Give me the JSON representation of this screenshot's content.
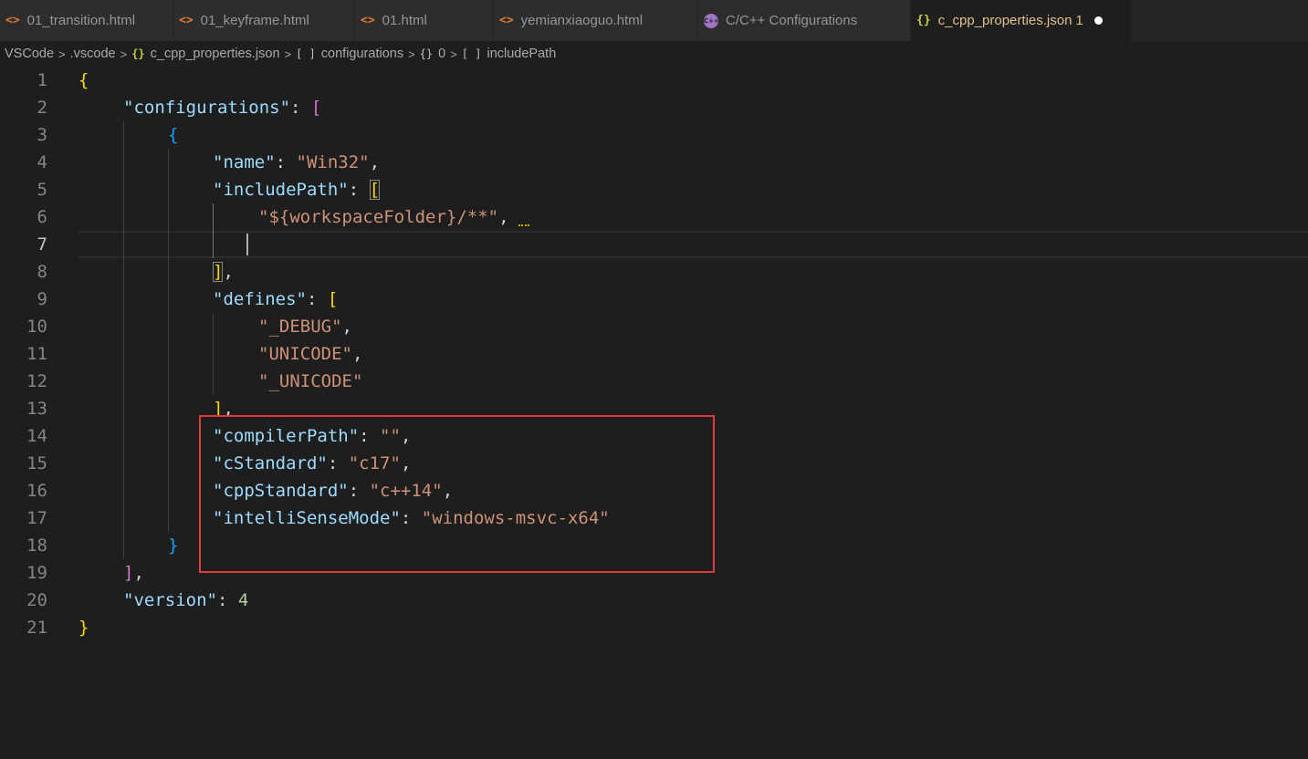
{
  "tabs": [
    {
      "label": "01_transition.html",
      "icon": "html-file-icon",
      "active": false
    },
    {
      "label": "01_keyframe.html",
      "icon": "html-file-icon",
      "active": false
    },
    {
      "label": "01.html",
      "icon": "html-file-icon",
      "active": false
    },
    {
      "label": "yemianxiaoguo.html",
      "icon": "html-file-icon",
      "active": false
    },
    {
      "label": "C/C++ Configurations",
      "icon": "cpp-extension-icon",
      "active": false
    },
    {
      "label": "c_cpp_properties.json",
      "icon": "json-file-icon",
      "active": true,
      "problem_count": "1",
      "dirty": true
    }
  ],
  "tab_icons": {
    "html": "<>",
    "json": "{}",
    "cpp": "C++"
  },
  "breadcrumb": {
    "items": [
      {
        "label": "VSCode"
      },
      {
        "label": ".vscode"
      },
      {
        "icon": "{}",
        "label": "c_cpp_properties.json"
      },
      {
        "icon": "[ ]",
        "label": "configurations"
      },
      {
        "icon": "{}",
        "label": "0"
      },
      {
        "icon": "[ ]",
        "label": "includePath"
      }
    ],
    "separator": ">"
  },
  "editor": {
    "current_line": 7,
    "line_numbers": [
      "1",
      "2",
      "3",
      "4",
      "5",
      "6",
      "7",
      "8",
      "9",
      "10",
      "11",
      "12",
      "13",
      "14",
      "15",
      "16",
      "17",
      "18",
      "19",
      "20",
      "21"
    ],
    "code": {
      "l1_open": "{",
      "l2_key": "\"configurations\"",
      "l2_colon": ": ",
      "l2_open": "[",
      "l3_open": "{",
      "l4_key": "\"name\"",
      "l4_colon": ": ",
      "l4_val": "\"Win32\"",
      "l4_comma": ",",
      "l5_key": "\"includePath\"",
      "l5_colon": ": ",
      "l5_open": "[",
      "l6_val": "\"${workspaceFolder}/**\"",
      "l6_comma": ",",
      "l8_close": "]",
      "l8_comma": ",",
      "l9_key": "\"defines\"",
      "l9_colon": ": ",
      "l9_open": "[",
      "l10_val": "\"_DEBUG\"",
      "l10_comma": ",",
      "l11_val": "\"UNICODE\"",
      "l11_comma": ",",
      "l12_val": "\"_UNICODE\"",
      "l13_close": "]",
      "l13_comma": ",",
      "l14_key": "\"compilerPath\"",
      "l14_colon": ": ",
      "l14_val": "\"\"",
      "l14_comma": ",",
      "l15_key": "\"cStandard\"",
      "l15_colon": ": ",
      "l15_val": "\"c17\"",
      "l15_comma": ",",
      "l16_key": "\"cppStandard\"",
      "l16_colon": ": ",
      "l16_val": "\"c++14\"",
      "l16_comma": ",",
      "l17_key": "\"intelliSenseMode\"",
      "l17_colon": ": ",
      "l17_val": "\"windows-msvc-x64\"",
      "l18_close": "}",
      "l19_close": "]",
      "l19_comma": ",",
      "l20_key": "\"version\"",
      "l20_colon": ": ",
      "l20_val": "4",
      "l21_close": "}"
    }
  },
  "colors": {
    "key": "#9cdcfe",
    "string": "#ce9178",
    "number": "#b5cea8",
    "bracket_level1": "#ffd700",
    "bracket_level2": "#da70d6",
    "bracket_level3": "#179fff",
    "annotation_box": "#e0393e"
  }
}
